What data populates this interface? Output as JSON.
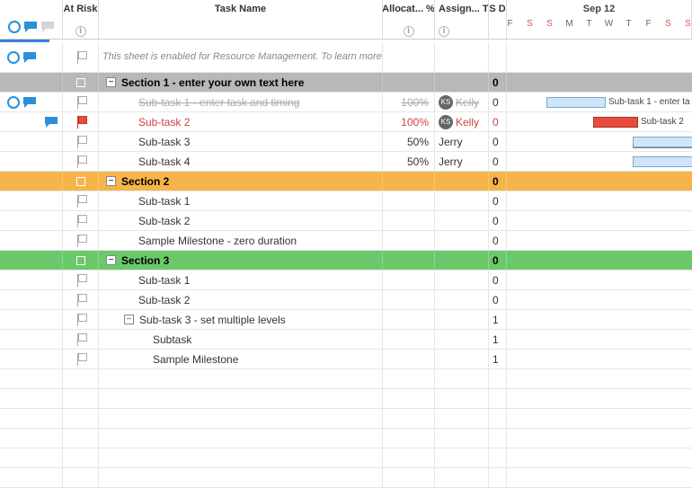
{
  "columns": {
    "risk_label": "At Risk",
    "name_label": "Task Name",
    "alloc_label": "Allocat... %",
    "assign_label": "Assign... To",
    "date_label": "S D"
  },
  "gantt_header": {
    "title": "Sep 12",
    "days": [
      "F",
      "S",
      "S",
      "M",
      "T",
      "W",
      "T",
      "F",
      "S",
      "S"
    ]
  },
  "info_text": "This sheet is enabled for Resource Management. To learn more, click the help link in the comments column.",
  "sections": {
    "s1": {
      "title": "Section 1 - enter your own text here",
      "date": "0"
    },
    "s2": {
      "title": "Section 2",
      "date": "0"
    },
    "s3": {
      "title": "Section 3",
      "date": "0"
    }
  },
  "rows": {
    "r1": {
      "name": "Sub-task 1 - enter task and timing",
      "alloc": "100%",
      "assign_initials": "KS",
      "assign": "Kelly",
      "date": "0",
      "bar_label": "Sub-task 1 - enter ta"
    },
    "r2": {
      "name": "Sub-task 2",
      "alloc": "100%",
      "assign_initials": "KS",
      "assign": "Kelly",
      "date": "0",
      "bar_label": "Sub-task 2"
    },
    "r3": {
      "name": "Sub-task 3",
      "alloc": "50%",
      "assign": "Jerry",
      "date": "0"
    },
    "r4": {
      "name": "Sub-task 4",
      "alloc": "50%",
      "assign": "Jerry",
      "date": "0"
    },
    "r5": {
      "name": "Sub-task 1",
      "date": "0"
    },
    "r6": {
      "name": "Sub-task 2",
      "date": "0"
    },
    "r7": {
      "name": "Sample Milestone - zero duration",
      "date": "0"
    },
    "r8": {
      "name": "Sub-task 1",
      "date": "0"
    },
    "r9": {
      "name": "Sub-task 2",
      "date": "0"
    },
    "r10": {
      "name": "Sub-task 3 - set multiple levels",
      "date": "1"
    },
    "r11": {
      "name": "Subtask",
      "date": "1"
    },
    "r12": {
      "name": "Sample Milestone",
      "date": "1"
    }
  }
}
